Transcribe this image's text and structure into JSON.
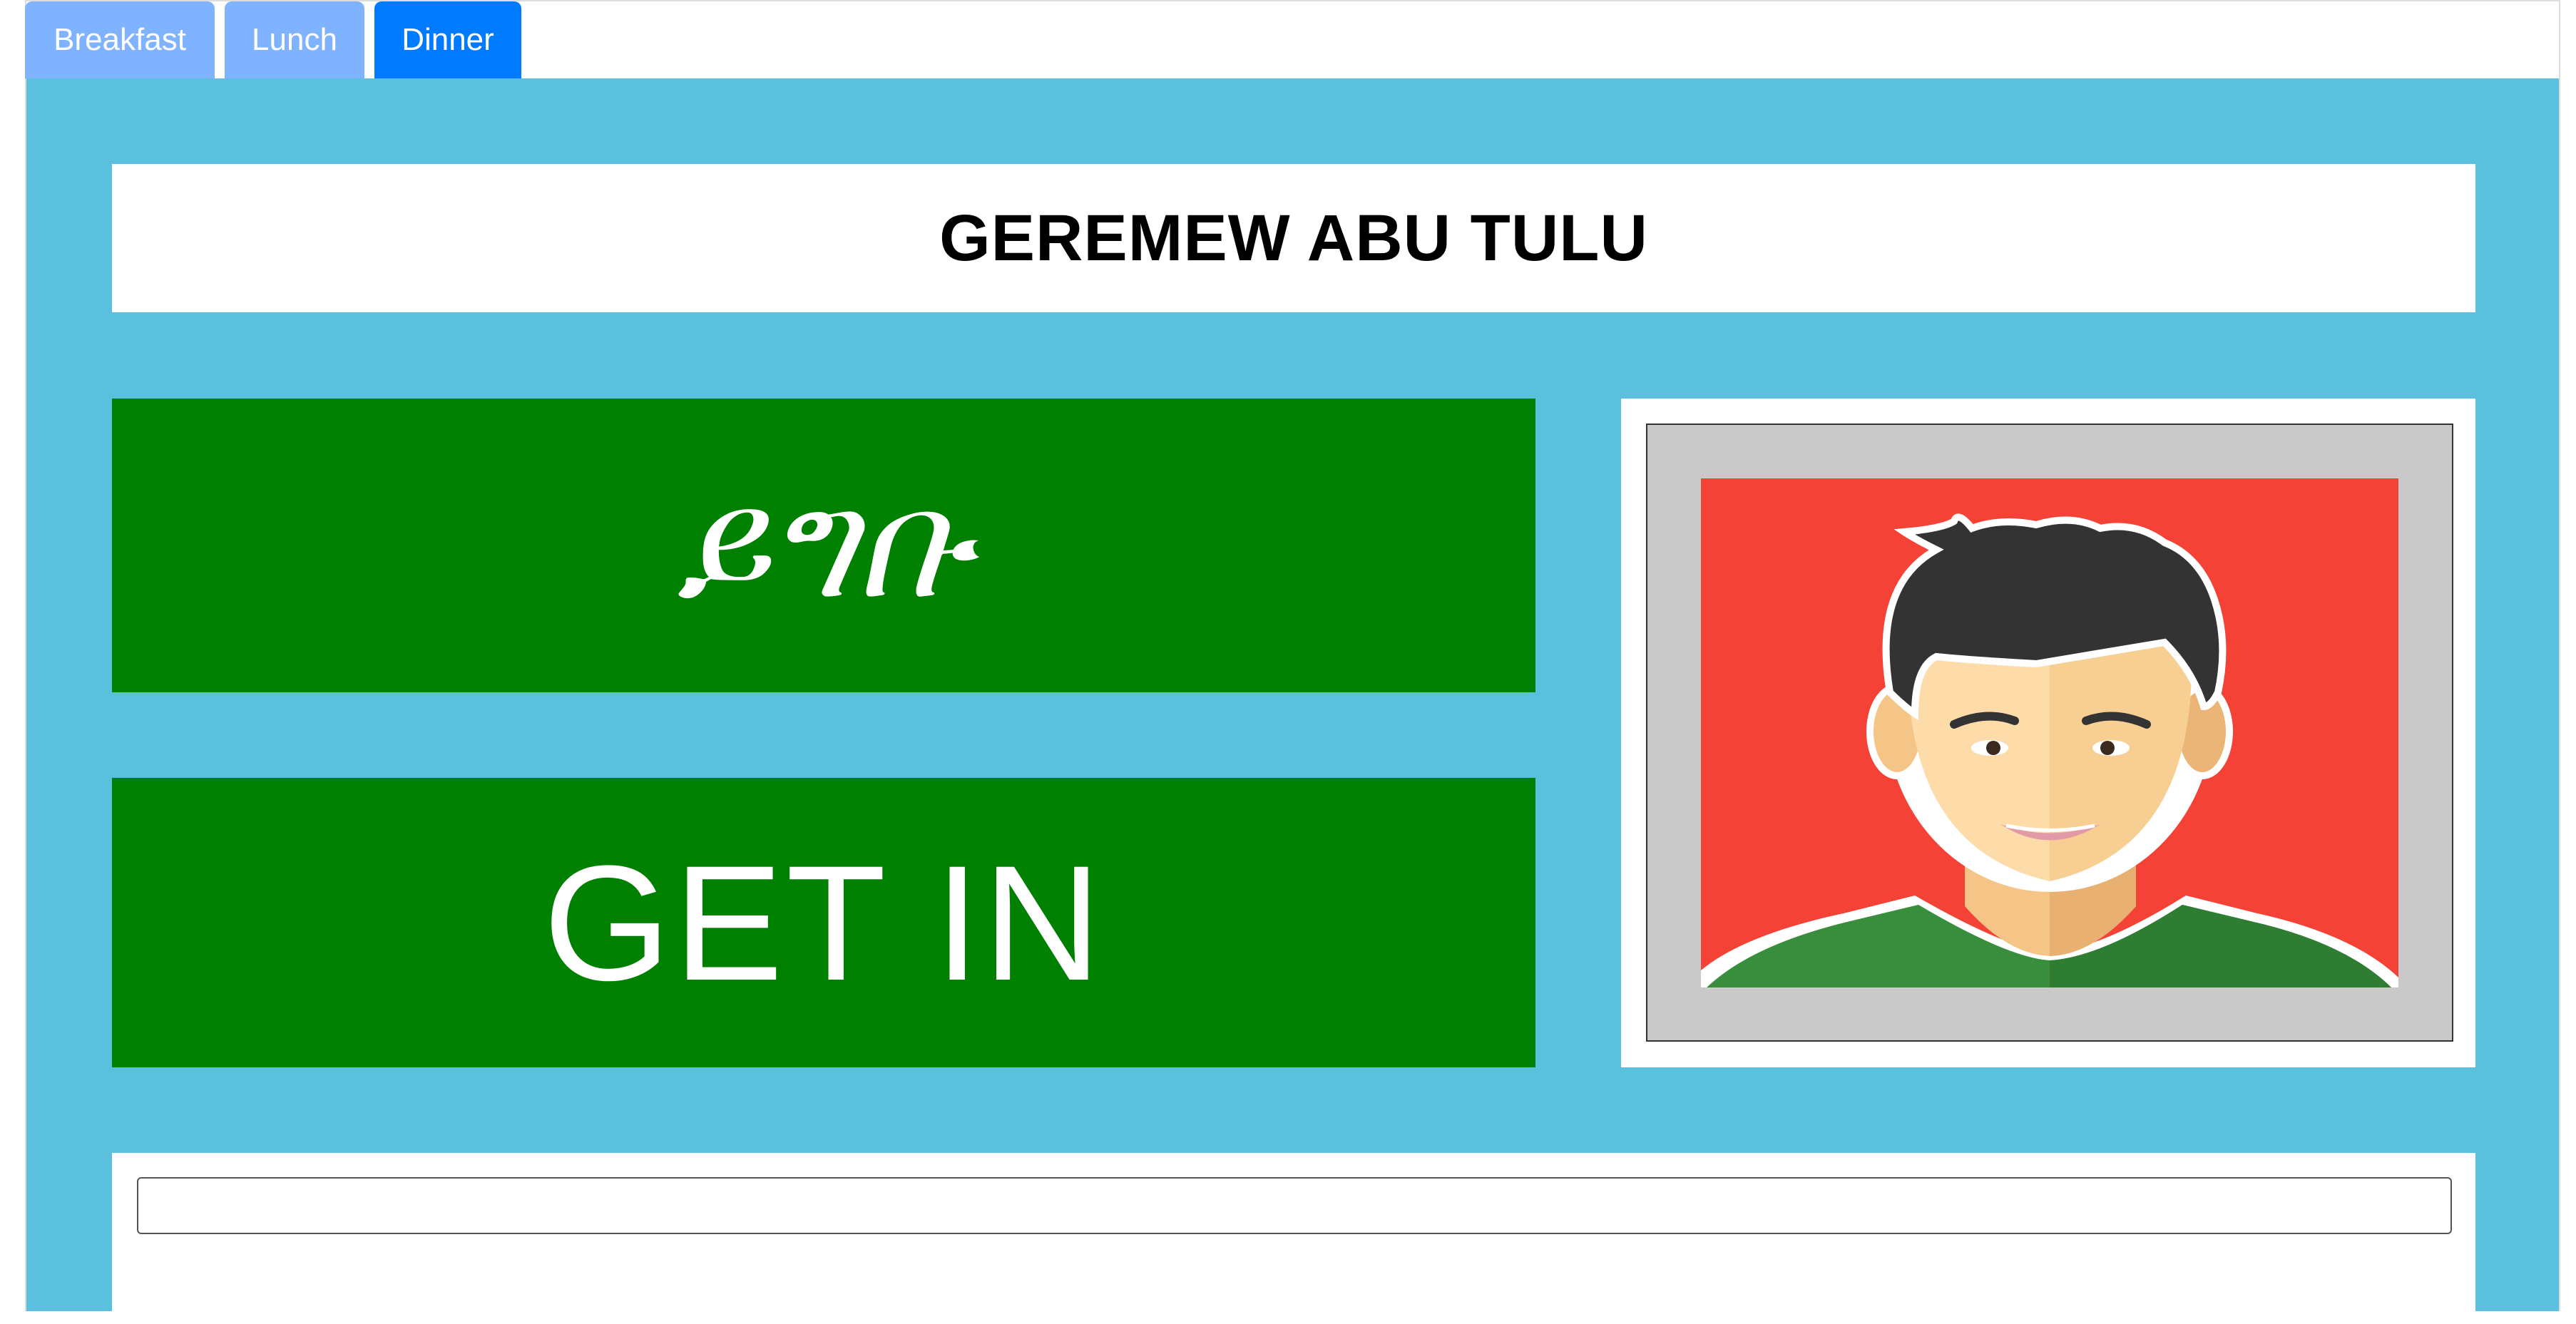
{
  "tabs": [
    {
      "label": "Breakfast",
      "active": false
    },
    {
      "label": "Lunch",
      "active": false
    },
    {
      "label": "Dinner",
      "active": true
    }
  ],
  "person": {
    "name": "GEREMEW ABU TULU"
  },
  "buttons": {
    "amharic_label": "ይግቡ",
    "english_label": "GET IN"
  },
  "photo": {
    "icon": "avatar-photo",
    "background_color": "#f44336"
  },
  "scan_input": {
    "value": "",
    "placeholder": ""
  },
  "colors": {
    "panel": "#5bc0de",
    "button": "#008000",
    "tab_active": "#007bff",
    "tab_inactive": "#80b3ff"
  }
}
